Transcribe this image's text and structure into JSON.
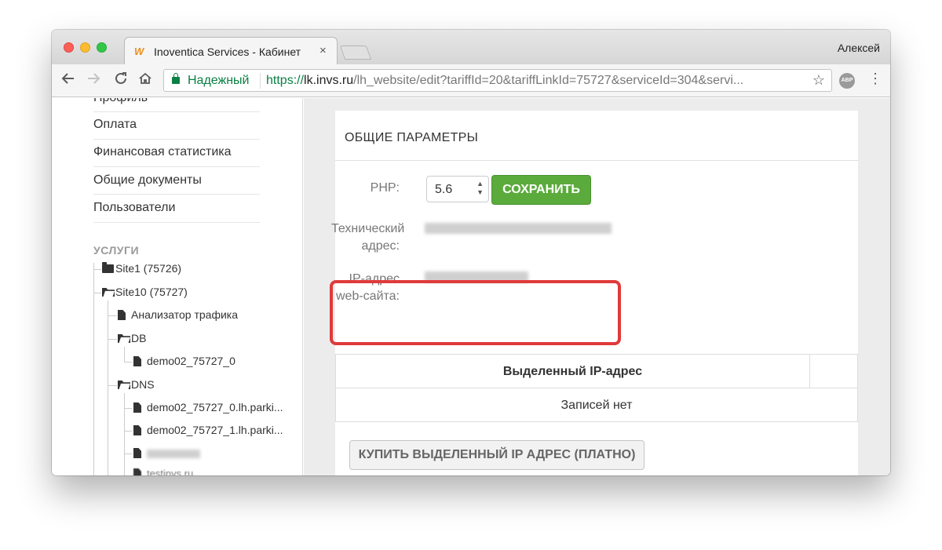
{
  "browser": {
    "tab_title": "Inoventica Services - Кабинет",
    "tab_favicon": "W",
    "tab_close": "×",
    "user_name": "Алексей",
    "secure_label": "Надежный",
    "url_scheme": "https://",
    "url_host": "lk.invs.ru",
    "url_path": "/lh_website/edit?tariffId=20&tariffLinkId=75727&serviceId=304&servi...",
    "icons": {
      "back": "back-arrow-icon",
      "forward": "forward-arrow-icon",
      "reload": "reload-icon",
      "home": "home-icon",
      "star": "bookmark-star-icon",
      "abp": "adblock-plus-icon",
      "menu": "menu-kebab-icon"
    },
    "abp_label": "ABP"
  },
  "sidebar": {
    "items": [
      {
        "label": "Профиль"
      },
      {
        "label": "Оплата"
      },
      {
        "label": "Финансовая статистика"
      },
      {
        "label": "Общие документы"
      },
      {
        "label": "Пользователи"
      }
    ],
    "services_title": "УСЛУГИ",
    "tree": {
      "site1": "Site1 (75726)",
      "site10": "Site10 (75727)",
      "analyzer": "Анализатор трафика",
      "db": "DB",
      "db_item": "demo02_75727_0",
      "dns": "DNS",
      "dns_item_1": "demo02_75727_0.lh.parki...",
      "dns_item_2": "demo02_75727_1.lh.parki...",
      "partial_item": "testinvs.ru"
    }
  },
  "main": {
    "section_title": "ОБЩИЕ ПАРАМЕТРЫ",
    "php_label": "PHP:",
    "php_value": "5.6",
    "save_button": "СОХРАНИТЬ",
    "tech_address_label": "Технический адрес:",
    "ip_label": "IP-адрес web-сайта:",
    "ip_table_header": "Выделенный IP-адрес",
    "ip_table_empty": "Записей нет",
    "buy_button": "КУПИТЬ ВЫДЕЛЕННЫЙ IP АДРЕС (ПЛАТНО)",
    "highlight_color": "#e03a3a",
    "save_button_color": "#5aab3b"
  }
}
